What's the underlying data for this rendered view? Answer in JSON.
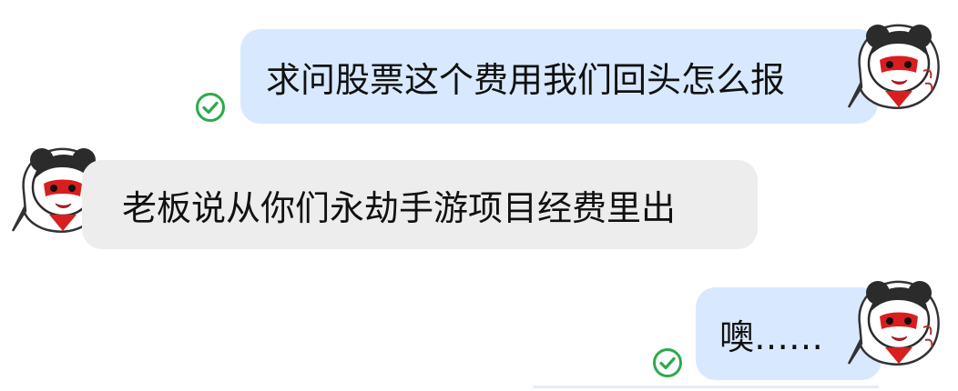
{
  "messages": [
    {
      "direction": "outgoing",
      "text": "求问股票这个费用我们回头怎么报",
      "status_icon": "check-circle-icon",
      "avatar_icon": "cartoon-avatar-icon"
    },
    {
      "direction": "incoming",
      "text": "老板说从你们永劫手游项目经费里出",
      "avatar_icon": "cartoon-avatar-icon"
    },
    {
      "direction": "outgoing",
      "text": "噢……",
      "status_icon": "check-circle-icon",
      "avatar_icon": "cartoon-avatar-icon"
    }
  ],
  "colors": {
    "outgoing_bubble": "#d8e9ff",
    "incoming_bubble": "#ededed",
    "check": "#2bab4b",
    "avatar_red": "#d81e1e"
  }
}
